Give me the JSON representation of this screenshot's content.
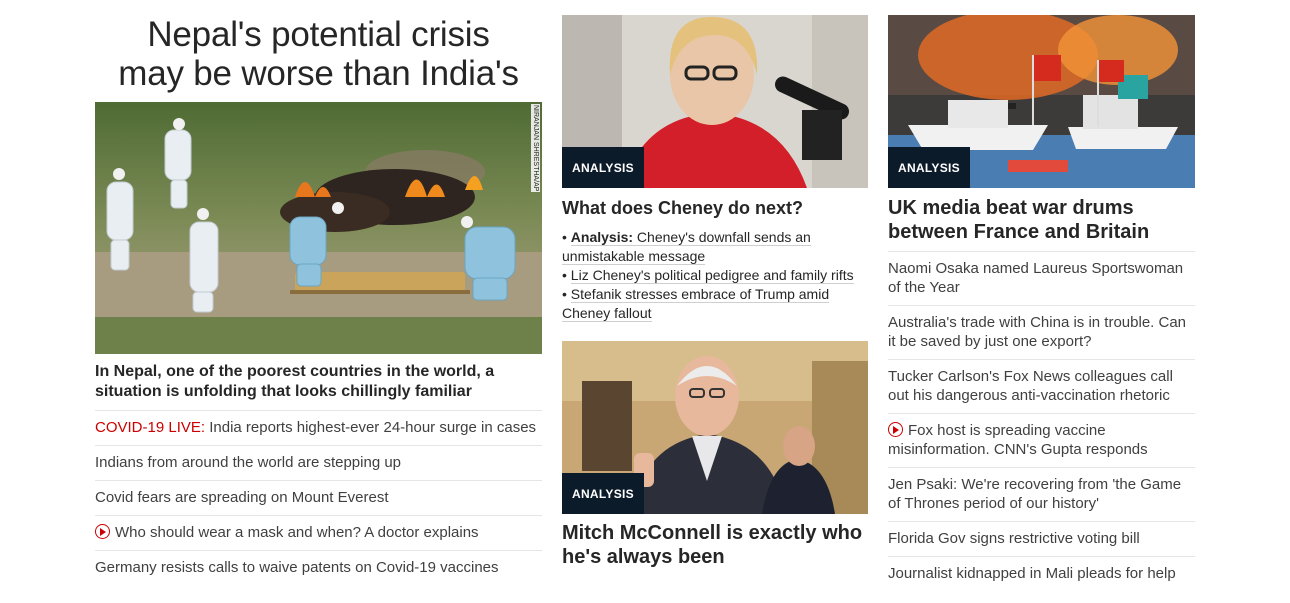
{
  "hero": {
    "headline_line1": "Nepal's potential crisis",
    "headline_line2": "may be worse than India's",
    "photo_credit": "NIRANJAN SHRESTHA/AP",
    "subhead": "In Nepal, one of the poorest countries in the world, a situation is unfolding that looks chillingly familiar",
    "links": [
      {
        "prefix": "COVID-19 LIVE:",
        "text": " India reports highest-ever 24-hour surge in cases"
      },
      {
        "text": "Indians from around the world are stepping up"
      },
      {
        "text": "Covid fears are spreading on Mount Everest"
      },
      {
        "video": true,
        "text": "Who should wear a mask and when? A doctor explains"
      },
      {
        "text": "Germany resists calls to waive patents on Covid-19 vaccines"
      }
    ]
  },
  "cheney": {
    "badge": "ANALYSIS",
    "title": "What does Cheney do next?",
    "bullets": [
      {
        "lead": "Analysis:",
        "text": " Cheney's downfall sends an unmistakable message"
      },
      {
        "text": "Liz Cheney's political pedigree and family rifts"
      },
      {
        "text": "Stefanik stresses embrace of Trump amid Cheney fallout"
      }
    ]
  },
  "mcconnell": {
    "badge": "ANALYSIS",
    "title": "Mitch McConnell is exactly who he's always been"
  },
  "uk": {
    "badge": "ANALYSIS",
    "title": "UK media beat war drums between France and Britain",
    "links": [
      {
        "text": "Naomi Osaka named Laureus Sportswoman of the Year"
      },
      {
        "text": "Australia's trade with China is in trouble. Can it be saved by just one export?"
      },
      {
        "text": "Tucker Carlson's Fox News colleagues call out his dangerous anti-vaccination rhetoric"
      },
      {
        "video": true,
        "text": "Fox host is spreading vaccine misinformation. CNN's Gupta responds"
      },
      {
        "text": "Jen Psaki: We're recovering from 'the Game of Thrones period of our history'"
      },
      {
        "text": "Florida Gov signs restrictive voting bill"
      },
      {
        "text": "Journalist kidnapped in Mali pleads for help"
      }
    ]
  },
  "colors": {
    "badge_bg": "#0c1b29",
    "accent_red": "#cc0000",
    "text": "#262626",
    "divider": "#e6e6e6"
  },
  "icons": {
    "video": "play-circle-icon"
  }
}
